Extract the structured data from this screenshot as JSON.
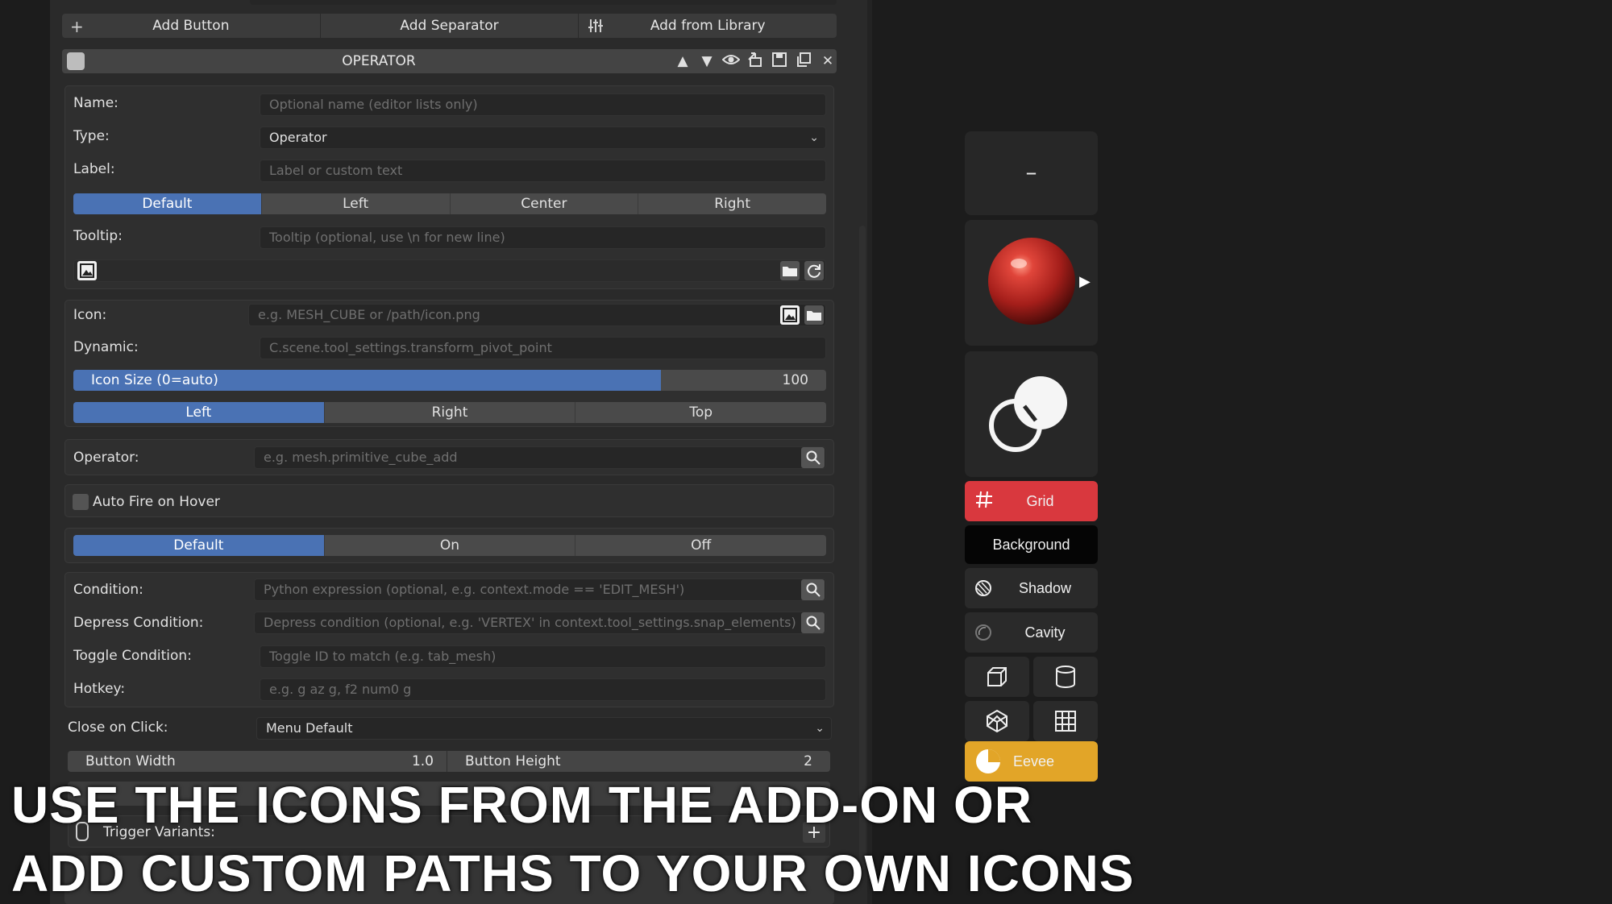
{
  "toolbar": {
    "add_button": "Add Button",
    "add_separator": "Add Separator",
    "add_from_library": "Add from Library"
  },
  "header": {
    "title": "OPERATOR"
  },
  "form": {
    "name_label": "Name:",
    "name_placeholder": "Optional name (editor lists only)",
    "type_label": "Type:",
    "type_value": "Operator",
    "label_label": "Label:",
    "label_placeholder": "Label or custom text",
    "align_options": [
      "Default",
      "Left",
      "Center",
      "Right"
    ],
    "tooltip_label": "Tooltip:",
    "tooltip_placeholder": "Tooltip (optional, use \\n for new line)",
    "icon_label": "Icon:",
    "icon_placeholder": "e.g. MESH_CUBE or /path/icon.png",
    "dynamic_label": "Dynamic:",
    "dynamic_placeholder": "C.scene.tool_settings.transform_pivot_point",
    "icon_size_label": "Icon Size (0=auto)",
    "icon_size_value": "100",
    "icon_size_fill": 0.78,
    "icon_pos_options": [
      "Left",
      "Right",
      "Top"
    ],
    "operator_label": "Operator:",
    "operator_placeholder": "e.g. mesh.primitive_cube_add",
    "auto_fire_label": "Auto Fire on Hover",
    "fire_options": [
      "Default",
      "On",
      "Off"
    ],
    "condition_label": "Condition:",
    "condition_placeholder": "Python expression (optional, e.g. context.mode == 'EDIT_MESH')",
    "depress_label": "Depress Condition:",
    "depress_placeholder": "Depress condition (optional, e.g. 'VERTEX' in context.tool_settings.snap_elements)",
    "toggle_label": "Toggle Condition:",
    "toggle_placeholder": "Toggle ID to match (e.g. tab_mesh)",
    "hotkey_label": "Hotkey:",
    "hotkey_placeholder": "e.g. g   az   g, f2   num0 g",
    "close_label": "Close on Click:",
    "close_value": "Menu Default",
    "button_width_label": "Button Width",
    "button_width_value": "1.0",
    "button_height_label": "Button Height",
    "button_height_value": "2",
    "trigger_variants_label": "Trigger Variants:"
  },
  "right_panel": {
    "minus": "–",
    "grid": "Grid",
    "background": "Background",
    "shadow": "Shadow",
    "cavity": "Cavity",
    "eevee": "Eevee",
    "grid_color": "#d9383e",
    "eevee_color": "#e2a528"
  },
  "caption": {
    "line1": "USE THE ICONS FROM THE ADD-ON OR",
    "line2": "ADD CUSTOM PATHS TO YOUR OWN ICONS"
  }
}
